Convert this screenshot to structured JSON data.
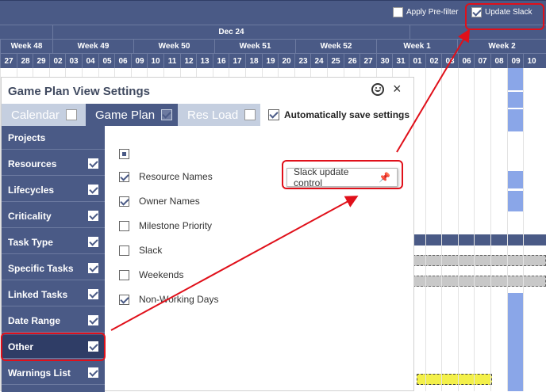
{
  "topbar": {
    "apply_prefilter_label": "Apply Pre-filter",
    "apply_prefilter_checked": false,
    "update_slack_label": "Update Slack",
    "update_slack_checked": true
  },
  "timeline": {
    "month": "Dec 24",
    "weeks": [
      "Week 48",
      "Week 49",
      "Week 50",
      "Week 51",
      "Week 52",
      "Week 1",
      "Week 2"
    ],
    "days": [
      "27",
      "28",
      "29",
      "02",
      "03",
      "04",
      "05",
      "06",
      "09",
      "10",
      "11",
      "12",
      "13",
      "16",
      "17",
      "18",
      "19",
      "20",
      "23",
      "24",
      "25",
      "26",
      "27",
      "30",
      "31",
      "01",
      "02",
      "03",
      "06",
      "07",
      "08",
      "09",
      "10"
    ]
  },
  "dialog": {
    "title": "Game Plan View Settings",
    "tabs": [
      {
        "label": "Calendar",
        "checked": false
      },
      {
        "label": "Game Plan",
        "checked": true
      },
      {
        "label": "Res Load",
        "checked": false
      }
    ],
    "auto_save_label": "Automatically save settings",
    "auto_save_checked": true,
    "sidebar": [
      {
        "label": "Projects",
        "checked": null
      },
      {
        "label": "Resources",
        "checked": true
      },
      {
        "label": "Lifecycles",
        "checked": true
      },
      {
        "label": "Criticality",
        "checked": true
      },
      {
        "label": "Task Type",
        "checked": true
      },
      {
        "label": "Specific Tasks",
        "checked": true
      },
      {
        "label": "Linked Tasks",
        "checked": true
      },
      {
        "label": "Date Range",
        "checked": true
      },
      {
        "label": "Other",
        "checked": true
      },
      {
        "label": "Warnings List",
        "checked": true
      }
    ],
    "options": [
      {
        "label": "Resource Names",
        "checked": true
      },
      {
        "label": "Owner Names",
        "checked": true
      },
      {
        "label": "Milestone Priority",
        "checked": false
      },
      {
        "label": "Slack",
        "checked": false
      },
      {
        "label": "Weekends",
        "checked": false
      },
      {
        "label": "Non-Working Days",
        "checked": true
      }
    ],
    "tooltip": "Slack update control"
  },
  "colors": {
    "header": "#4a5a86",
    "active_tab": "#4a5a86",
    "inactive_tab": "#c5cfe0",
    "annotation": "#e0101a",
    "highlight_bar": "#8aa6e8"
  }
}
